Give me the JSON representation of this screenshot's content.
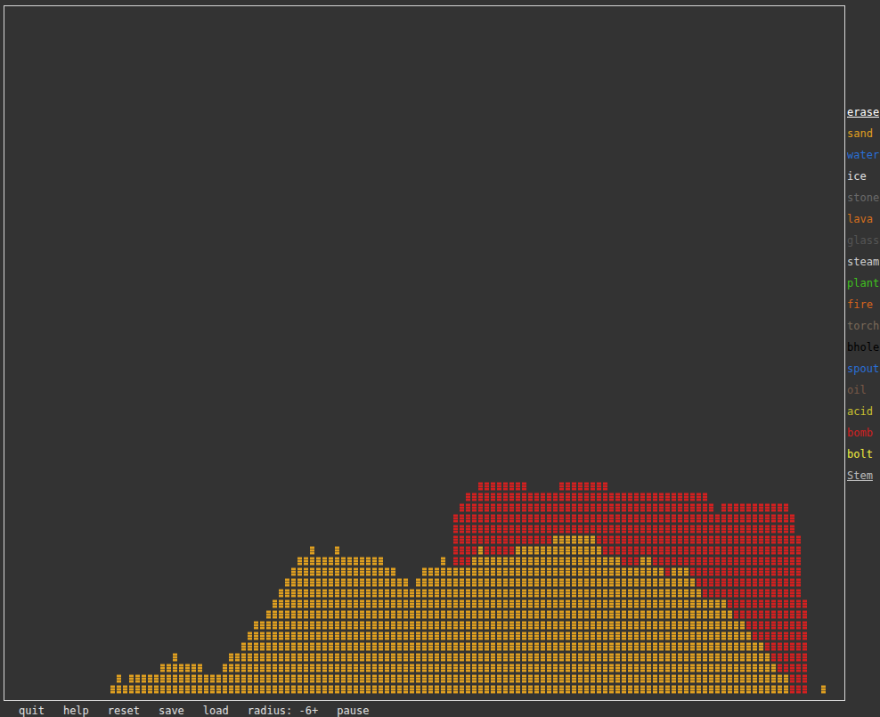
{
  "menu": {
    "items": [
      {
        "label": "erase",
        "selected": true,
        "color": "#ffffff"
      },
      {
        "label": "sand",
        "selected": false,
        "color": "#e0a020"
      },
      {
        "label": "water",
        "selected": false,
        "color": "#2a6fd8"
      },
      {
        "label": "ice",
        "selected": false,
        "color": "#e0e0e0"
      },
      {
        "label": "stone",
        "selected": false,
        "color": "#6a6a6a"
      },
      {
        "label": "lava",
        "selected": false,
        "color": "#d8701c"
      },
      {
        "label": "glass",
        "selected": false,
        "color": "#555555"
      },
      {
        "label": "steam",
        "selected": false,
        "color": "#cfcfcf"
      },
      {
        "label": "plant",
        "selected": false,
        "color": "#3fc21e"
      },
      {
        "label": "fire",
        "selected": false,
        "color": "#d8641c"
      },
      {
        "label": "torch",
        "selected": false,
        "color": "#7a6a5a"
      },
      {
        "label": "bhole",
        "selected": false,
        "color": "#000000"
      },
      {
        "label": "spout",
        "selected": false,
        "color": "#2a6fd8"
      },
      {
        "label": "oil",
        "selected": false,
        "color": "#7a5a48"
      },
      {
        "label": "acid",
        "selected": false,
        "color": "#c8c030"
      },
      {
        "label": "bomb",
        "selected": false,
        "color": "#d42020"
      },
      {
        "label": "bolt",
        "selected": false,
        "color": "#f0f040"
      },
      {
        "label": "Stem",
        "selected": true,
        "color": "#bdbdbd"
      }
    ]
  },
  "field": {
    "rows": [
      {
        "row": 45,
        "spans": [
          {
            "from": 76,
            "to": 83,
            "material": "bomb"
          },
          {
            "from": 89,
            "to": 96,
            "material": "bomb"
          }
        ]
      },
      {
        "row": 46,
        "spans": [
          {
            "from": 74,
            "to": 112,
            "material": "bomb"
          }
        ]
      },
      {
        "row": 47,
        "spans": [
          {
            "from": 73,
            "to": 113,
            "material": "bomb"
          },
          {
            "from": 115,
            "to": 125,
            "material": "bomb"
          }
        ]
      },
      {
        "row": 48,
        "spans": [
          {
            "from": 72,
            "to": 126,
            "material": "bomb"
          }
        ]
      },
      {
        "row": 49,
        "spans": [
          {
            "from": 72,
            "to": 126,
            "material": "bomb"
          }
        ]
      },
      {
        "row": 50,
        "spans": [
          {
            "from": 72,
            "to": 87,
            "material": "bomb"
          },
          {
            "from": 88,
            "to": 94,
            "material": "sand"
          },
          {
            "from": 95,
            "to": 127,
            "material": "bomb"
          }
        ]
      },
      {
        "row": 51,
        "spans": [
          {
            "from": 49,
            "to": 49,
            "material": "sand"
          },
          {
            "from": 53,
            "to": 53,
            "material": "sand"
          },
          {
            "from": 72,
            "to": 75,
            "material": "bomb"
          },
          {
            "from": 76,
            "to": 76,
            "material": "sand"
          },
          {
            "from": 77,
            "to": 81,
            "material": "bomb"
          },
          {
            "from": 82,
            "to": 95,
            "material": "sand"
          },
          {
            "from": 96,
            "to": 127,
            "material": "bomb"
          }
        ]
      },
      {
        "row": 52,
        "spans": [
          {
            "from": 47,
            "to": 60,
            "material": "sand"
          },
          {
            "from": 70,
            "to": 70,
            "material": "sand"
          },
          {
            "from": 72,
            "to": 74,
            "material": "bomb"
          },
          {
            "from": 75,
            "to": 98,
            "material": "sand"
          },
          {
            "from": 99,
            "to": 101,
            "material": "bomb"
          },
          {
            "from": 102,
            "to": 103,
            "material": "sand"
          },
          {
            "from": 104,
            "to": 127,
            "material": "bomb"
          }
        ]
      },
      {
        "row": 53,
        "spans": [
          {
            "from": 46,
            "to": 62,
            "material": "sand"
          },
          {
            "from": 67,
            "to": 105,
            "material": "sand"
          },
          {
            "from": 106,
            "to": 106,
            "material": "bomb"
          },
          {
            "from": 107,
            "to": 109,
            "material": "sand"
          },
          {
            "from": 110,
            "to": 127,
            "material": "bomb"
          }
        ]
      },
      {
        "row": 54,
        "spans": [
          {
            "from": 45,
            "to": 64,
            "material": "sand"
          },
          {
            "from": 66,
            "to": 110,
            "material": "sand"
          },
          {
            "from": 111,
            "to": 127,
            "material": "bomb"
          }
        ]
      },
      {
        "row": 55,
        "spans": [
          {
            "from": 44,
            "to": 111,
            "material": "sand"
          },
          {
            "from": 112,
            "to": 127,
            "material": "bomb"
          }
        ]
      },
      {
        "row": 56,
        "spans": [
          {
            "from": 43,
            "to": 115,
            "material": "sand"
          },
          {
            "from": 116,
            "to": 128,
            "material": "bomb"
          }
        ]
      },
      {
        "row": 57,
        "spans": [
          {
            "from": 42,
            "to": 116,
            "material": "sand"
          },
          {
            "from": 117,
            "to": 128,
            "material": "bomb"
          }
        ]
      },
      {
        "row": 58,
        "spans": [
          {
            "from": 40,
            "to": 118,
            "material": "sand"
          },
          {
            "from": 119,
            "to": 128,
            "material": "bomb"
          }
        ]
      },
      {
        "row": 59,
        "spans": [
          {
            "from": 39,
            "to": 119,
            "material": "sand"
          },
          {
            "from": 120,
            "to": 128,
            "material": "bomb"
          }
        ]
      },
      {
        "row": 60,
        "spans": [
          {
            "from": 38,
            "to": 121,
            "material": "sand"
          },
          {
            "from": 122,
            "to": 128,
            "material": "bomb"
          }
        ]
      },
      {
        "row": 61,
        "spans": [
          {
            "from": 27,
            "to": 27,
            "material": "sand"
          },
          {
            "from": 36,
            "to": 122,
            "material": "sand"
          },
          {
            "from": 123,
            "to": 128,
            "material": "bomb"
          }
        ]
      },
      {
        "row": 62,
        "spans": [
          {
            "from": 25,
            "to": 31,
            "material": "sand"
          },
          {
            "from": 35,
            "to": 123,
            "material": "sand"
          },
          {
            "from": 124,
            "to": 128,
            "material": "bomb"
          }
        ]
      },
      {
        "row": 63,
        "spans": [
          {
            "from": 18,
            "to": 18,
            "material": "sand"
          },
          {
            "from": 20,
            "to": 125,
            "material": "sand"
          },
          {
            "from": 126,
            "to": 128,
            "material": "bomb"
          }
        ]
      },
      {
        "row": 64,
        "spans": [
          {
            "from": 17,
            "to": 125,
            "material": "sand"
          },
          {
            "from": 126,
            "to": 128,
            "material": "bomb"
          },
          {
            "from": 131,
            "to": 131,
            "material": "sand"
          }
        ]
      }
    ]
  },
  "status_bar": [
    "quit",
    "help",
    "reset",
    "save",
    "load",
    "radius: -6+",
    "pause"
  ]
}
